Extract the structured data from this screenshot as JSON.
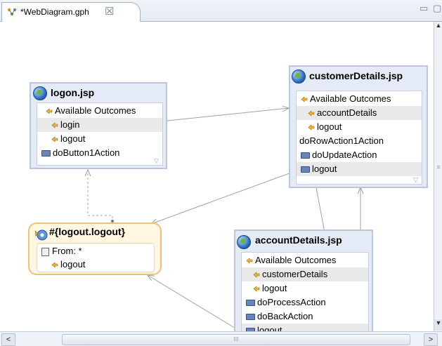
{
  "tab": {
    "title": "*WebDiagram.gph",
    "close": "☒"
  },
  "controls": {
    "minimize": "▭",
    "maximize": "▢"
  },
  "nodes": {
    "logon": {
      "title": "logon.jsp",
      "rows": [
        "Available Outcomes",
        "login",
        "logout",
        "doButton1Action"
      ]
    },
    "customerDetails": {
      "title": "customerDetails.jsp",
      "rows": [
        "Available Outcomes",
        "accountDetails",
        "logout",
        "doRowAction1Action",
        "doUpdateAction",
        "logout"
      ]
    },
    "logoutAction": {
      "title": "#{logout.logout}",
      "rows": [
        "From: *",
        "logout"
      ]
    },
    "accountDetails": {
      "title": "accountDetails.jsp",
      "rows": [
        "Available Outcomes",
        "customerDetails",
        "logout",
        "doProcessAction",
        "doBackAction",
        "logout"
      ]
    }
  },
  "scrollbars": {
    "left": "<",
    "right": ">",
    "up": "▲",
    "down": "▼",
    "grip": "III",
    "vgrip": "≡"
  },
  "colors": {
    "page_node_border": "#b9c6dc",
    "action_node_border": "#e7c479",
    "connector": "#a0a0a0"
  }
}
